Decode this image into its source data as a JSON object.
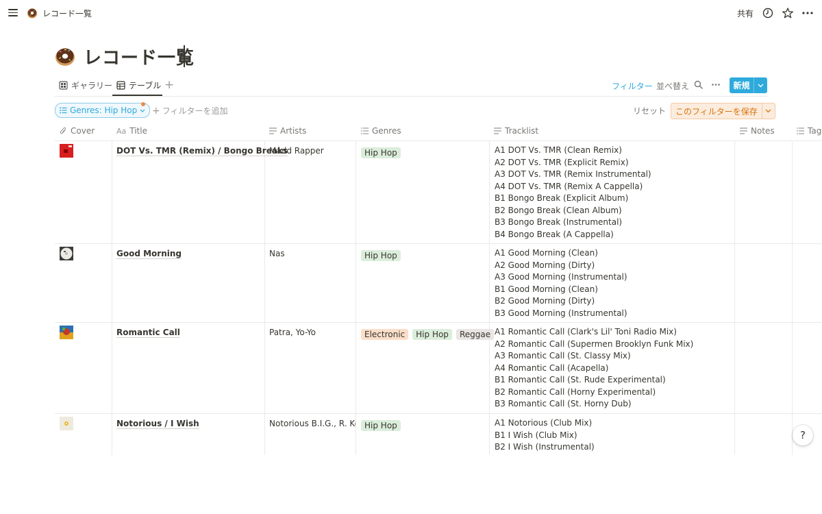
{
  "topbar": {
    "breadcrumb": "レコード一覧",
    "share_label": "共有",
    "icons": [
      "menu-icon",
      "donut-emoji-icon",
      "clock-icon",
      "star-icon",
      "more-icon"
    ]
  },
  "page": {
    "title": "レコード一覧",
    "emoji": "donut-emoji-icon"
  },
  "views": {
    "tabs": [
      {
        "label": "ギャラリー",
        "icon": "gallery-icon"
      },
      {
        "label": "テーブル",
        "icon": "table-icon",
        "active": true
      }
    ],
    "add_view_icon": "plus-icon"
  },
  "toolbar": {
    "filter_label": "フィルター",
    "sort_label": "並べ替え",
    "new_label": "新規",
    "accent_color": "#2eaadc"
  },
  "filters": {
    "active_filter": "Genres: Hip Hop",
    "add_filter_label": "フィルターを追加",
    "reset_label": "リセット",
    "save_label": "このフィルターを保存"
  },
  "table": {
    "columns": [
      "Cover",
      "Title",
      "Artists",
      "Genres",
      "Tracklist",
      "Notes",
      "Tag"
    ],
    "rows": [
      {
        "cover_color": "#d71f1f",
        "title": "DOT Vs. TMR (Remix) / Bongo Breaks",
        "artists": "Madd Rapper",
        "genres": [
          "Hip Hop"
        ],
        "tracklist": [
          "A1 DOT Vs. TMR (Clean Remix)",
          "A2 DOT Vs. TMR (Explicit Remix)",
          "A3 DOT Vs. TMR (Remix Instrumental)",
          "A4 DOT Vs. TMR (Remix A Cappella)",
          "B1 Bongo Break (Explicit Album)",
          "B2 Bongo Break (Clean Album)",
          "B3 Bongo Break (Instrumental)",
          "B4 Bongo Break (A Cappella)"
        ]
      },
      {
        "cover_color": "#e8e8e4",
        "title": "Good Morning",
        "artists": "Nas",
        "genres": [
          "Hip Hop"
        ],
        "tracklist": [
          "A1 Good Morning (Clean)",
          "A2 Good Morning (Dirty)",
          "A3 Good Morning (Instrumental)",
          "B1 Good Morning (Clean)",
          "B2 Good Morning (Dirty)",
          "B3 Good Morning (Instrumental)"
        ]
      },
      {
        "cover_color": "#c0392b",
        "title": "Romantic Call",
        "artists": "Patra, Yo-Yo",
        "genres": [
          "Electronic",
          "Hip Hop",
          "Reggae"
        ],
        "tracklist": [
          "A1 Romantic Call (Clark's Lil' Toni Radio Mix)",
          "A2 Romantic Call (Supermen Brooklyn Funk Mix)",
          "A3 Romantic Call (St. Classy Mix)",
          "A4 Romantic Call (Acapella)",
          "B1 Romantic Call (St. Rude Experimental)",
          "B2 Romantic Call (Horny Experimental)",
          "B3 Romantic Call (St. Horny Dub)"
        ]
      },
      {
        "cover_color": "#f2efe4",
        "title": "Notorious / I Wish",
        "artists": "Notorious B.I.G., R. Kelly",
        "genres": [
          "Hip Hop"
        ],
        "tracklist": [
          "A1 Notorious (Club Mix)",
          "B1 I Wish (Club Mix)",
          "B2 I Wish (Instrumental)"
        ]
      }
    ]
  },
  "help": {
    "label": "?"
  }
}
